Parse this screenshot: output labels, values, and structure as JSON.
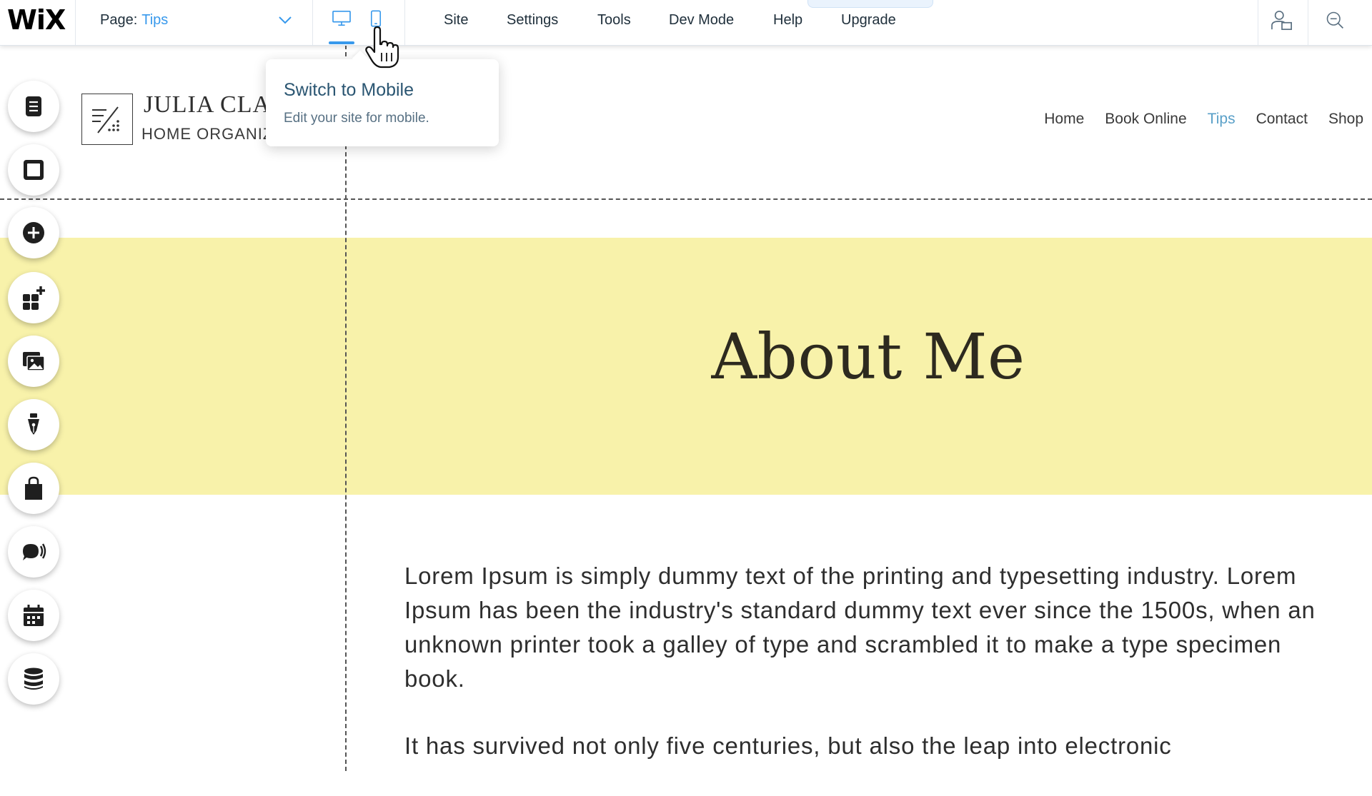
{
  "topbar": {
    "logo": "WiX",
    "page_label": "Page:",
    "page_value": "Tips",
    "menu": [
      "Site",
      "Settings",
      "Tools",
      "Dev Mode",
      "Help",
      "Upgrade"
    ]
  },
  "tooltip": {
    "title": "Switch to Mobile",
    "description": "Edit your site for mobile."
  },
  "site": {
    "name": "JULIA CLAF",
    "subtitle": "HOME ORGANIZ",
    "nav": [
      "Home",
      "Book Online",
      "Tips",
      "Contact",
      "Shop"
    ],
    "active_nav": "Tips",
    "hero_title": "About Me",
    "paragraph_1": "Lorem Ipsum is simply dummy text of the printing and typesetting industry. Lorem Ipsum has been the industry's standard dummy text ever since the 1500s, when an unknown printer took a galley of type and scrambled it to make a type specimen book.",
    "paragraph_2": "It has survived not only five centuries, but also the leap into electronic"
  },
  "left_toolbar": [
    "pages-icon",
    "background-icon",
    "add-icon",
    "add-apps-icon",
    "media-icon",
    "blog-icon",
    "store-icon",
    "chat-icon",
    "bookings-icon",
    "database-icon"
  ],
  "colors": {
    "accent": "#3899ec",
    "hero_bg": "#f8f2aa",
    "nav_active": "#5aa0c8"
  }
}
